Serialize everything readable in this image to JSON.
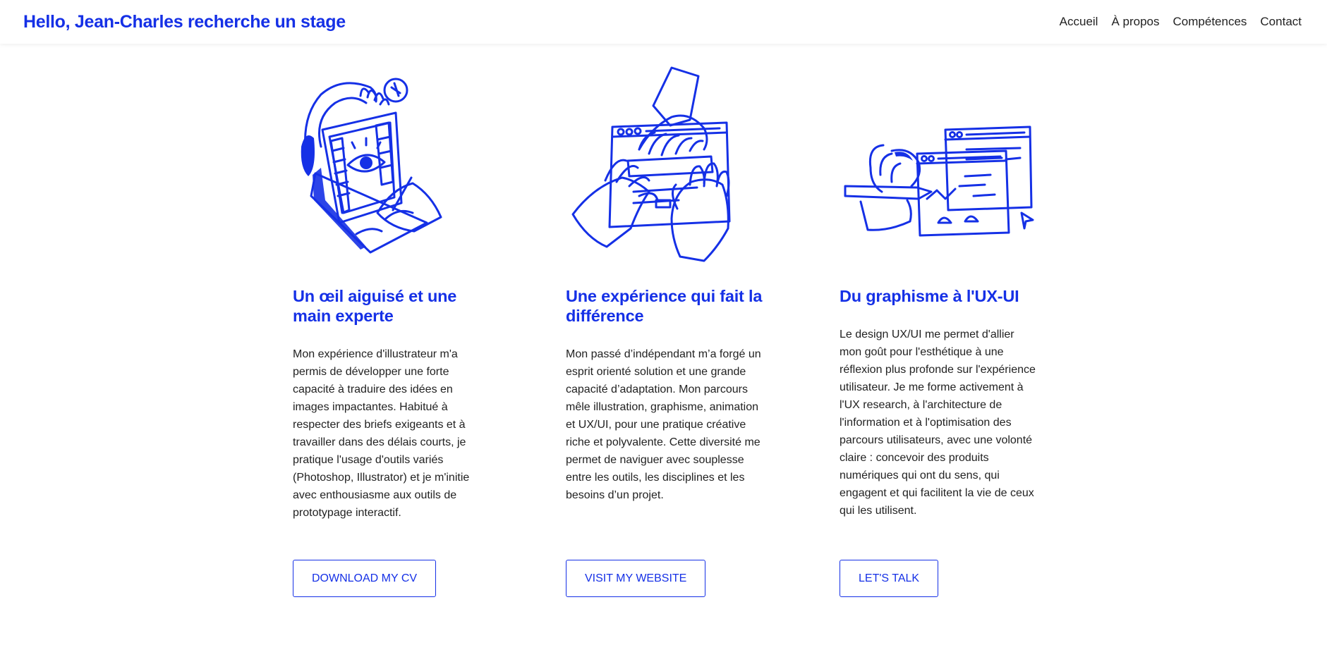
{
  "header": {
    "brand": "Hello, Jean-Charles recherche un stage",
    "nav": [
      "Accueil",
      "À propos",
      "Compétences",
      "Contact"
    ]
  },
  "columns": [
    {
      "illustration": "illustrator-drawing-icon",
      "title": "Un œil aiguisé et une main experte",
      "body": "Mon expérience d'illustrateur m'a permis de développer une forte capacité à traduire des idées en images impactantes. Habitué à respecter des briefs exigeants et à travailler dans des délais courts, je pratique l'usage d'outils variés (Photoshop, Illustrator) et je m'initie avec enthousiasme aux outils de prototypage interactif.",
      "button": "Download my CV"
    },
    {
      "illustration": "hands-on-screen-icon",
      "title": "Une expérience qui fait la différence",
      "body": "Mon passé d’indépendant m’a forgé un esprit orienté solution et une grande capacité d’adaptation. Mon parcours mêle illustration, graphisme, animation et UX/UI, pour une pratique créative riche et polyvalente. Cette diversité me permet de naviguer avec souplesse entre les outils, les disciplines et les besoins d’un projet.",
      "button": "Visit my website"
    },
    {
      "illustration": "ux-wireframe-icon",
      "title": "Du graphisme à l'UX-UI",
      "body": "Le design UX/UI me permet d'allier mon goût pour l'esthétique à une réflexion plus profonde sur l'expérience utilisateur. Je me forme activement à l'UX research, à l'architecture de l'information et à l'optimisation des parcours utilisateurs, avec une volonté claire : concevoir des produits numériques qui ont du sens, qui engagent et qui facilitent la vie de ceux qui les utilisent.",
      "button": "Let's talk"
    }
  ],
  "colors": {
    "accent": "#1530e6",
    "text": "#222222",
    "background": "#ffffff"
  }
}
